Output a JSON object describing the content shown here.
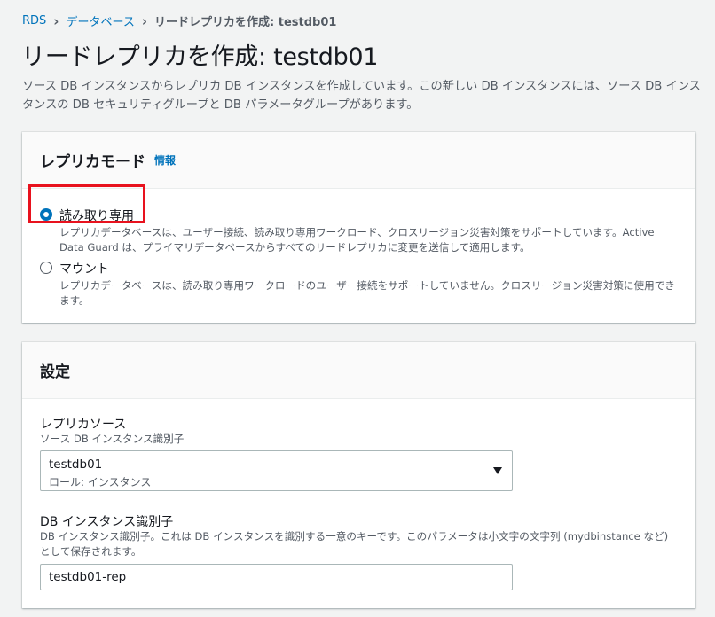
{
  "breadcrumb": {
    "items": [
      "RDS",
      "データベース"
    ],
    "current": "リードレプリカを作成: testdb01"
  },
  "page": {
    "title": "リードレプリカを作成: testdb01",
    "description": "ソース DB インスタンスからレプリカ DB インスタンスを作成しています。この新しい DB インスタンスには、ソース DB インスタンスの DB セキュリティグループと DB パラメータグループがあります。"
  },
  "replica_mode": {
    "title": "レプリカモード",
    "info_link": "情報",
    "options": [
      {
        "label": "読み取り専用",
        "description": "レプリカデータベースは、ユーザー接続、読み取り専用ワークロード、クロスリージョン災害対策をサポートしています。Active Data Guard は、プライマリデータベースからすべてのリードレプリカに変更を送信して適用します。",
        "selected": true
      },
      {
        "label": "マウント",
        "description": "レプリカデータベースは、読み取り専用ワークロードのユーザー接続をサポートしていません。クロスリージョン災害対策に使用できます。",
        "selected": false
      }
    ]
  },
  "settings": {
    "title": "設定",
    "replica_source": {
      "label": "レプリカソース",
      "hint": "ソース DB インスタンス識別子",
      "value": "testdb01",
      "sub": "ロール: インスタンス"
    },
    "instance_identifier": {
      "label": "DB インスタンス識別子",
      "hint": "DB インスタンス識別子。これは DB インスタンスを識別する一意のキーです。このパラメータは小文字の文字列 (mydbinstance など) として保存されます。",
      "value": "testdb01-rep"
    }
  },
  "colors": {
    "accent": "#0073bb",
    "highlight": "#e8121e"
  }
}
